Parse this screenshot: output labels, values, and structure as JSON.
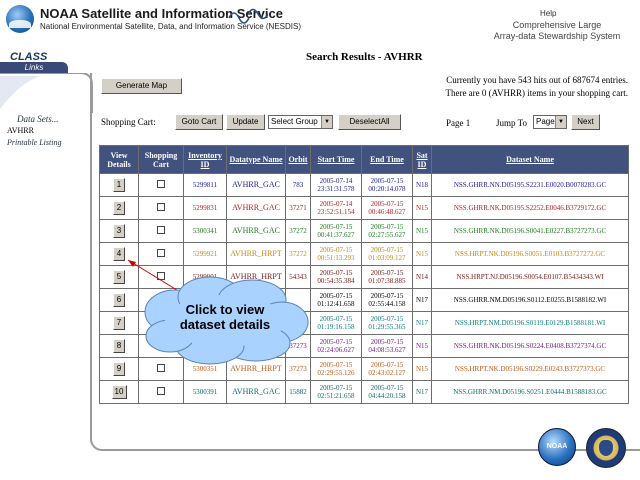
{
  "header": {
    "title": "NOAA Satellite and Information Service",
    "subtitle": "National Environmental Satellite, Data, and Information Service (NESDIS)",
    "help": "Help",
    "class_line1": "Comprehensive Large",
    "class_line2": "Array-data Stewardship System"
  },
  "sidebar": {
    "class_label": "CLASS",
    "links_label": "Links",
    "datasets_label": "Data Sets...",
    "avhrr_label": "AVHRR",
    "printable_label": "Printable Listing"
  },
  "page": {
    "title": "Search Results - AVHRR",
    "generate_map": "Generate Map",
    "hits_text": "Currently you have 543 hits out of 687674 entries.",
    "cart_text": "There are 0 (AVHRR) items in your shopping cart.",
    "shopping_cart_label": "Shopping Cart:",
    "goto_cart": "Goto Cart",
    "update": "Update",
    "select_group": "Select Group",
    "deselect_all": "DeselectAll",
    "page_label": "Page 1",
    "jump_to": "Jump To",
    "page_select": "Page",
    "next": "Next"
  },
  "table": {
    "headers": [
      "View Details",
      "Shopping Cart",
      "Inventory ID",
      "Datatype Name",
      "Orbit",
      "Start Time",
      "End Time",
      "Sat ID",
      "Dataset Name"
    ],
    "rows": [
      {
        "n": "1",
        "id": "5299811",
        "type": "AVHRR_GAC",
        "orbit": "783",
        "start1": "2005-07-14",
        "start2": "23:31:31.578",
        "end1": "2005-07-15",
        "end2": "00:20:14.078",
        "sat": "N18",
        "name": "NSS.GHRR.NN.D05195.S2231.E0020.B0078283.GC",
        "color": "#1a1aa6"
      },
      {
        "n": "2",
        "id": "5299831",
        "type": "AVHRR_GAC",
        "orbit": "37271",
        "start1": "2005-07-14",
        "start2": "23:52:51.154",
        "end1": "2005-07-15",
        "end2": "00:46:48.627",
        "sat": "N15",
        "name": "NSS.GHRR.NK.D05195.S2252.E0046.B3729172.GC",
        "color": "#c01818"
      },
      {
        "n": "3",
        "id": "5300341",
        "type": "AVHRR_GAC",
        "orbit": "37272",
        "start1": "2005-07-15",
        "start2": "00:41:37.627",
        "end1": "2005-07-15",
        "end2": "02:27:55.627",
        "sat": "N15",
        "name": "NSS.GHRR.NK.D05196.S0041.E0227.B3727273.GC",
        "color": "#1f7a1f"
      },
      {
        "n": "4",
        "id": "5299921",
        "type": "AVHRR_HRPT",
        "orbit": "37272",
        "start1": "2005-07-15",
        "start2": "00:51:13.293",
        "end1": "2005-07-15",
        "end2": "01:03:09.127",
        "sat": "N15",
        "name": "NSS.HRPT.NK.D05196.S0051.E0103.B3727272.GC",
        "color": "#c8881a"
      },
      {
        "n": "5",
        "id": "5299901",
        "type": "AVHRR_HRPT",
        "orbit": "54343",
        "start1": "2005-07-15",
        "start2": "00:54:35.384",
        "end1": "2005-07-15",
        "end2": "01:07:38.885",
        "sat": "N14",
        "name": "NSS.HRPT.NJ.D05196.S0054.E0107.B5434343.WI",
        "color": "#7a1515"
      },
      {
        "n": "6",
        "id": "",
        "type": "",
        "orbit": "",
        "start1": "2005-07-15",
        "start2": "01:12:41.658",
        "end1": "2005-07-15",
        "end2": "02:55:44.158",
        "sat": "N17",
        "name": "NSS.GHRR.NM.D05196.S0112.E0255.B1588182.WI",
        "color": "#000000"
      },
      {
        "n": "7",
        "id": "",
        "type": "",
        "orbit": "",
        "start1": "2005-07-15",
        "start2": "01:19:16.158",
        "end1": "2005-07-15",
        "end2": "01:29:55.365",
        "sat": "N17",
        "name": "NSS.HRPT.NM.D05196.S0119.E0129.B1588181.WI",
        "color": "#0f7a7a"
      },
      {
        "n": "8",
        "id": "",
        "type": "",
        "orbit": "37273",
        "start1": "2005-07-15",
        "start2": "02:24:06.627",
        "end1": "2005-07-15",
        "end2": "04:08:53.627",
        "sat": "N15",
        "name": "NSS.GHRR.NK.D05196.S0224.E0408.B3727374.GC",
        "color": "#7a1a8a"
      },
      {
        "n": "9",
        "id": "5300351",
        "type": "AVHRR_HRPT",
        "orbit": "37273",
        "start1": "2005-07-15",
        "start2": "02:29:55.126",
        "end1": "2005-07-15",
        "end2": "02:43:02.127",
        "sat": "N15",
        "name": "NSS.HRPT.NK.D05196.S0229.E0243.B3727373.GC",
        "color": "#c05a18"
      },
      {
        "n": "10",
        "id": "5300391",
        "type": "AVHRR_GAC",
        "orbit": "15882",
        "start1": "2005-07-15",
        "start2": "02:51:21.658",
        "end1": "2005-07-15",
        "end2": "04:44:20.158",
        "sat": "N17",
        "name": "NSS.GHRR.NM.D05196.S0251.E0444.B1588183.GC",
        "color": "#0f6b6b"
      }
    ]
  },
  "callout": {
    "line1": "Click to view",
    "line2": "dataset details"
  },
  "logos": {
    "noaa": "NOAA"
  }
}
